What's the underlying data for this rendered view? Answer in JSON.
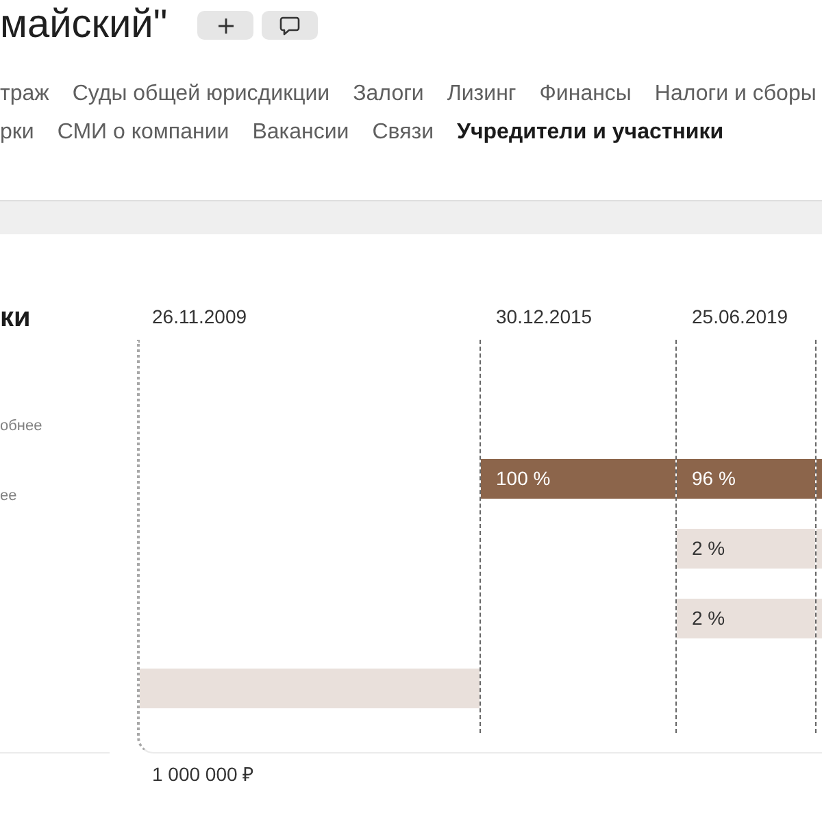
{
  "title": "майский\"",
  "nav": {
    "tabs": [
      {
        "label": "траж",
        "selected": false
      },
      {
        "label": "Суды общей юрисдикции",
        "selected": false
      },
      {
        "label": "Залоги",
        "selected": false
      },
      {
        "label": "Лизинг",
        "selected": false
      },
      {
        "label": "Финансы",
        "selected": false
      },
      {
        "label": "Налоги и сборы",
        "selected": false
      },
      {
        "label": "рки",
        "selected": false
      },
      {
        "label": "СМИ о компании",
        "selected": false
      },
      {
        "label": "Вакансии",
        "selected": false
      },
      {
        "label": "Связи",
        "selected": false
      },
      {
        "label": "Учредители и участники",
        "selected": true
      }
    ]
  },
  "participants": {
    "heading": "ки",
    "links": [
      "обнее",
      "ее"
    ]
  },
  "timeline": {
    "periods": [
      {
        "date": "26.11.2009",
        "capital": "1 000 000 ₽",
        "shares": [
          {
            "kind": "none"
          },
          {
            "kind": "none"
          },
          {
            "kind": "none"
          },
          {
            "kind": "minor"
          }
        ]
      },
      {
        "date": "30.12.2015",
        "shares": [
          {
            "kind": "major",
            "label": "100 %"
          },
          {
            "kind": "none"
          },
          {
            "kind": "none"
          },
          {
            "kind": "none"
          }
        ]
      },
      {
        "date": "25.06.2019",
        "shares": [
          {
            "kind": "major",
            "label": "96 %"
          },
          {
            "kind": "minor",
            "label": "2 %"
          },
          {
            "kind": "minor",
            "label": "2 %"
          },
          {
            "kind": "none"
          }
        ]
      },
      {
        "shares": [
          {
            "kind": "major"
          },
          {
            "kind": "minor"
          },
          {
            "kind": "minor"
          },
          {
            "kind": "none"
          }
        ]
      }
    ]
  }
}
